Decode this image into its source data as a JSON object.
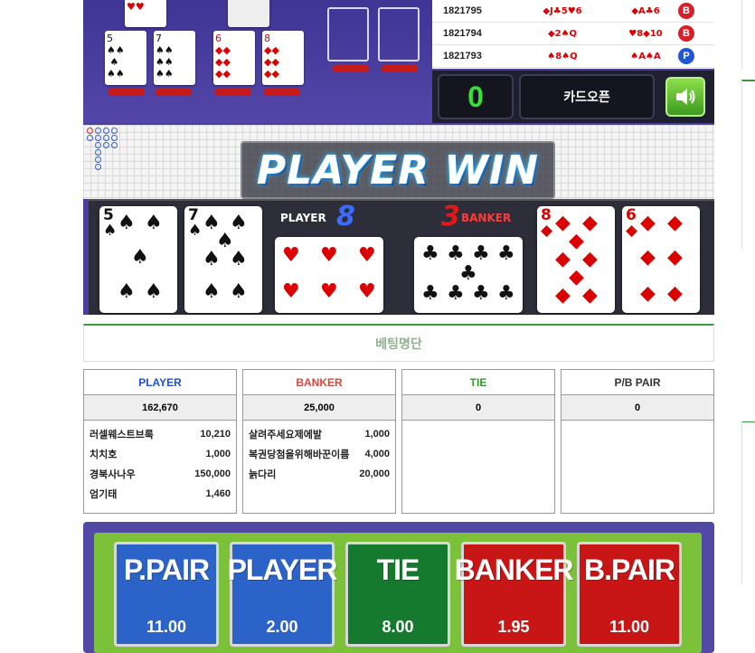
{
  "history": [
    {
      "id": "1821795",
      "player": "◆J♣5♥6",
      "banker": "◆A♣6",
      "result": "B"
    },
    {
      "id": "1821794",
      "player": "◆2♠Q",
      "banker": "♥8◆10",
      "result": "B"
    },
    {
      "id": "1821793",
      "player": "♠8♠Q",
      "banker": "♠A♠A",
      "result": "P"
    }
  ],
  "controls": {
    "counter": "0",
    "card_open": "카드오픈"
  },
  "banner": "PLAYER WIN",
  "reveal": {
    "player_label": "PLAYER",
    "player_score": "8",
    "banker_score": "3",
    "banker_label": "BANKER"
  },
  "bet_list_title": "베팅명단",
  "columns": [
    {
      "name": "PLAYER",
      "color": "#1f4fd6",
      "total": "162,670",
      "bets": [
        {
          "user": "러셀웨스트브룩",
          "amount": "10,210"
        },
        {
          "user": "치치호",
          "amount": "1,000"
        },
        {
          "user": "경북사나우",
          "amount": "150,000"
        },
        {
          "user": "엄기태",
          "amount": "1,460"
        }
      ]
    },
    {
      "name": "BANKER",
      "color": "#e0463a",
      "total": "25,000",
      "bets": [
        {
          "user": "살려주세요제에발",
          "amount": "1,000"
        },
        {
          "user": "복권당첨을위해바꾼이름",
          "amount": "4,000"
        },
        {
          "user": "늙다리",
          "amount": "20,000"
        }
      ]
    },
    {
      "name": "TIE",
      "color": "#2f9a2f",
      "total": "0",
      "bets": []
    },
    {
      "name": "P/B PAIR",
      "color": "#333333",
      "total": "0",
      "bets": []
    }
  ],
  "bet_buttons": [
    {
      "label": "P.PAIR",
      "odds": "11.00",
      "color": "#2c63c9"
    },
    {
      "label": "PLAYER",
      "odds": "2.00",
      "color": "#2c63c9"
    },
    {
      "label": "TIE",
      "odds": "8.00",
      "color": "#157a2e"
    },
    {
      "label": "BANKER",
      "odds": "1.95",
      "color": "#c81616"
    },
    {
      "label": "B.PAIR",
      "odds": "11.00",
      "color": "#c81616"
    }
  ]
}
